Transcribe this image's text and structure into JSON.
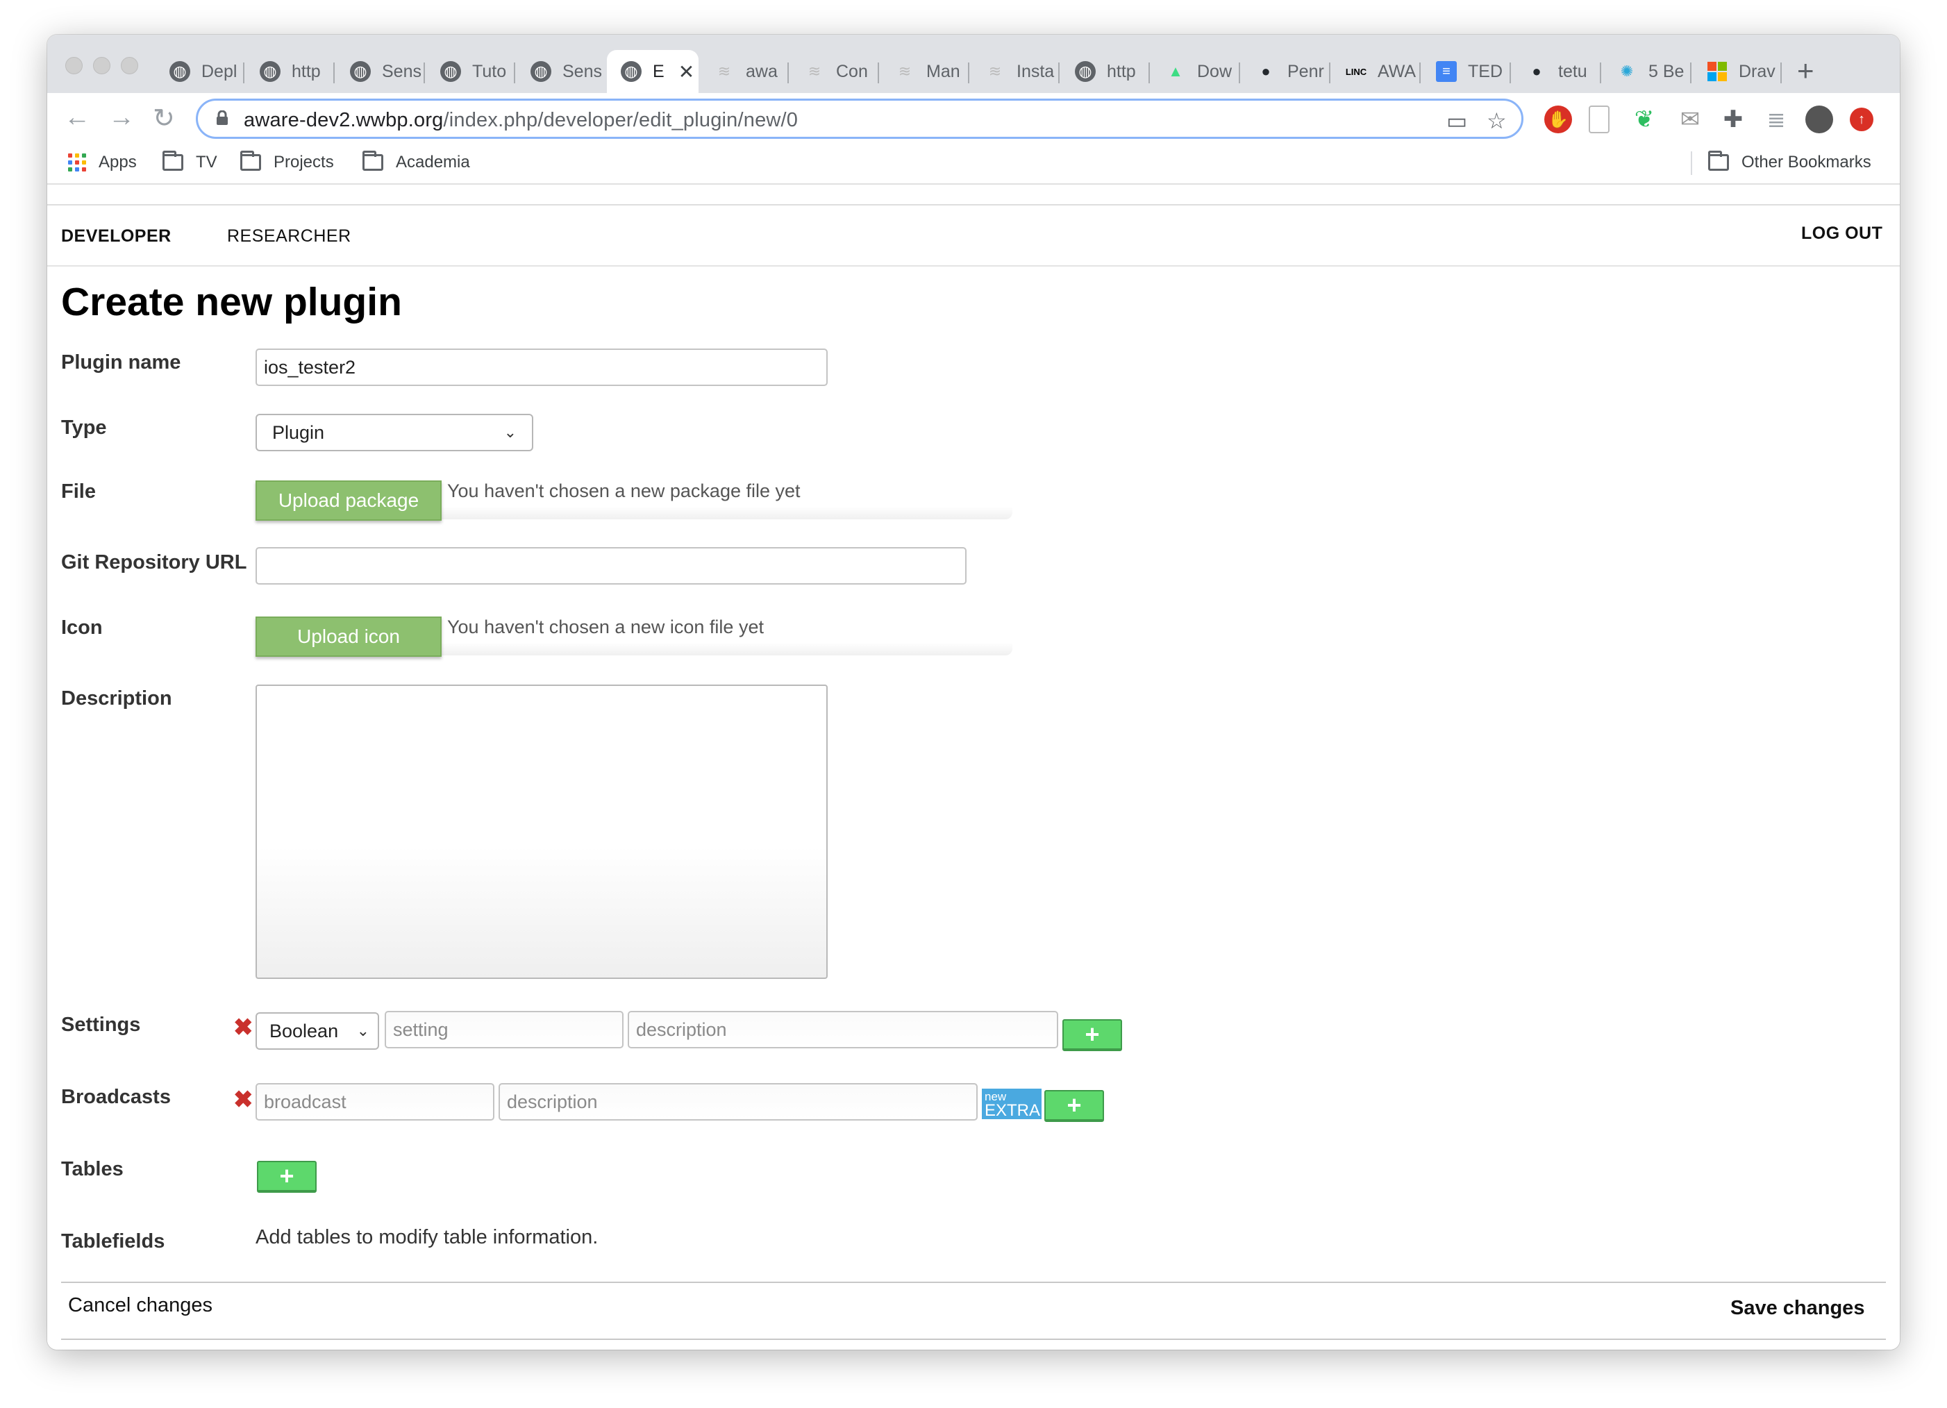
{
  "browser": {
    "tabs": [
      {
        "label": "Depl",
        "favicon": "globe-icon"
      },
      {
        "label": "http",
        "favicon": "globe-icon"
      },
      {
        "label": "Sens",
        "favicon": "globe-icon"
      },
      {
        "label": "Tuto",
        "favicon": "globe-icon"
      },
      {
        "label": "Sens",
        "favicon": "globe-icon"
      },
      {
        "label": "E",
        "favicon": "globe-icon",
        "active": true
      },
      {
        "label": "awa",
        "favicon": "aware-icon"
      },
      {
        "label": "Con",
        "favicon": "aware-icon"
      },
      {
        "label": "Man",
        "favicon": "aware-icon"
      },
      {
        "label": "Insta",
        "favicon": "aware-icon"
      },
      {
        "label": "http",
        "favicon": "globe-icon"
      },
      {
        "label": "Dow",
        "favicon": "android-icon"
      },
      {
        "label": "Penr",
        "favicon": "github-icon"
      },
      {
        "label": "AWA",
        "favicon": "linc-icon",
        "favicon_text": "LINC"
      },
      {
        "label": "TED",
        "favicon": "google-docs-icon"
      },
      {
        "label": "tetu",
        "favicon": "github-icon"
      },
      {
        "label": "5 Be",
        "favicon": "sparkle-icon"
      },
      {
        "label": "Drav",
        "favicon": "microsoft-icon"
      }
    ],
    "new_tab_symbol": "+",
    "close_tab_symbol": "✕",
    "url_host": "aware-dev2.wwbp.org",
    "url_path": "/index.php/developer/edit_plugin/new/0",
    "bookmarks": [
      {
        "label": "Apps",
        "icon": "apps-grid-icon"
      },
      {
        "label": "TV",
        "icon": "folder-icon"
      },
      {
        "label": "Projects",
        "icon": "folder-icon"
      },
      {
        "label": "Academia",
        "icon": "folder-icon"
      }
    ],
    "other_bookmarks": "Other Bookmarks"
  },
  "nav": {
    "developer": "DEVELOPER",
    "researcher": "RESEARCHER",
    "logout": "LOG OUT"
  },
  "form": {
    "title": "Create new plugin",
    "plugin_name_label": "Plugin name",
    "plugin_name_value": "ios_tester2",
    "type_label": "Type",
    "type_value": "Plugin",
    "file_label": "File",
    "upload_package": "Upload package",
    "package_status": "You haven't chosen a new package file yet",
    "git_label": "Git Repository URL",
    "git_value": "",
    "icon_label": "Icon",
    "upload_icon": "Upload icon",
    "icon_status": "You haven't chosen a new icon file yet",
    "description_label": "Description",
    "settings_label": "Settings",
    "settings_type": "Boolean",
    "settings_setting_placeholder": "setting",
    "settings_description_placeholder": "description",
    "broadcasts_label": "Broadcasts",
    "broadcast_placeholder": "broadcast",
    "broadcast_description_placeholder": "description",
    "extra_new": "new",
    "extra_label": "EXTRA",
    "tables_label": "Tables",
    "tablefields_label": "Tablefields",
    "tablefields_hint": "Add tables to modify table information.",
    "add_symbol": "+",
    "remove_symbol": "✖"
  },
  "footer": {
    "cancel": "Cancel changes",
    "save": "Save changes"
  },
  "colors": {
    "upload_button": "#8dc06f",
    "add_button": "#5dd86c",
    "extra_badge": "#4aa9e0",
    "remove_icon": "#c9302c",
    "omnibox_focus": "#8ab4f8"
  }
}
